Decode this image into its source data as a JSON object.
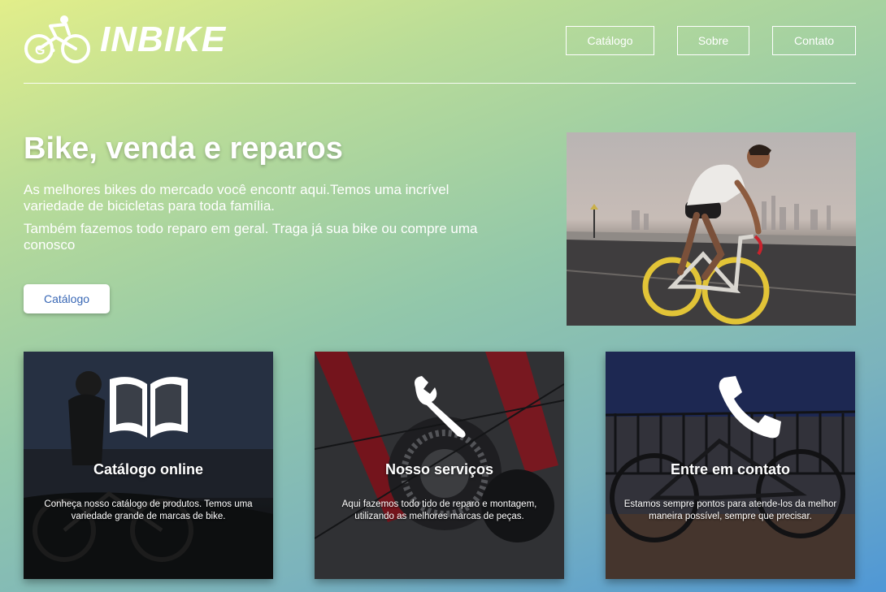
{
  "brand": {
    "name": "INBIKE",
    "logo_icon": "cyclist-go-icon"
  },
  "nav": {
    "items": [
      {
        "label": "Catálogo"
      },
      {
        "label": "Sobre"
      },
      {
        "label": "Contato"
      }
    ]
  },
  "hero": {
    "title": "Bike, venda e reparos",
    "paragraph1": "As melhores bikes do mercado você encontr aqui.Temos uma incrível variedade de bicicletas para toda família.",
    "paragraph2": "Também fazemos todo reparo em geral. Traga já sua bike ou compre uma conosco",
    "cta_label": "Catálogo"
  },
  "cards": [
    {
      "icon": "book-icon",
      "title": "Catálogo online",
      "text": "Conheça nosso catálogo de produtos. Temos uma variedade grande de marcas de bike."
    },
    {
      "icon": "wrench-icon",
      "title": "Nosso serviços",
      "text": "Aqui fazemos todo tido de reparo e montagem, utilizando as melhores marcas de peças."
    },
    {
      "icon": "phone-icon",
      "title": "Entre em contato",
      "text": "Estamos sempre pontos para atende-los da melhor maneira possível, sempre que precisar."
    }
  ],
  "colors": {
    "cta_text": "#3867b5",
    "gradient_start": "#e2ee8a",
    "gradient_end": "#4f97d6"
  }
}
